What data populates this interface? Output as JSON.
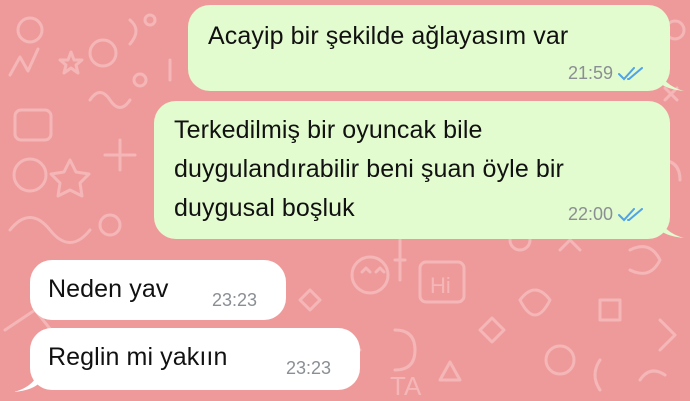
{
  "messages": [
    {
      "direction": "outgoing",
      "text_lines": [
        "Acayip bir şekilde ağlayasım var"
      ],
      "time": "21:59",
      "status_icon": "double-check-read-icon"
    },
    {
      "direction": "outgoing",
      "text_lines": [
        "Terkedilmiş bir oyuncak bile",
        "duygulandırabilir beni şuan öyle bir",
        "duygusal boşluk"
      ],
      "time": "22:00",
      "status_icon": "double-check-read-icon"
    },
    {
      "direction": "incoming",
      "text_lines": [
        "Neden yav"
      ],
      "time": "23:23"
    },
    {
      "direction": "incoming",
      "text_lines": [
        "Reglin mi yakıın"
      ],
      "time": "23:23"
    }
  ],
  "colors": {
    "wallpaper": "#ee9a9a",
    "outgoing_bubble": "#e2fbcf",
    "incoming_bubble": "#ffffff",
    "read_ticks": "#4fa3e6",
    "timestamp": "#8a8f94"
  }
}
